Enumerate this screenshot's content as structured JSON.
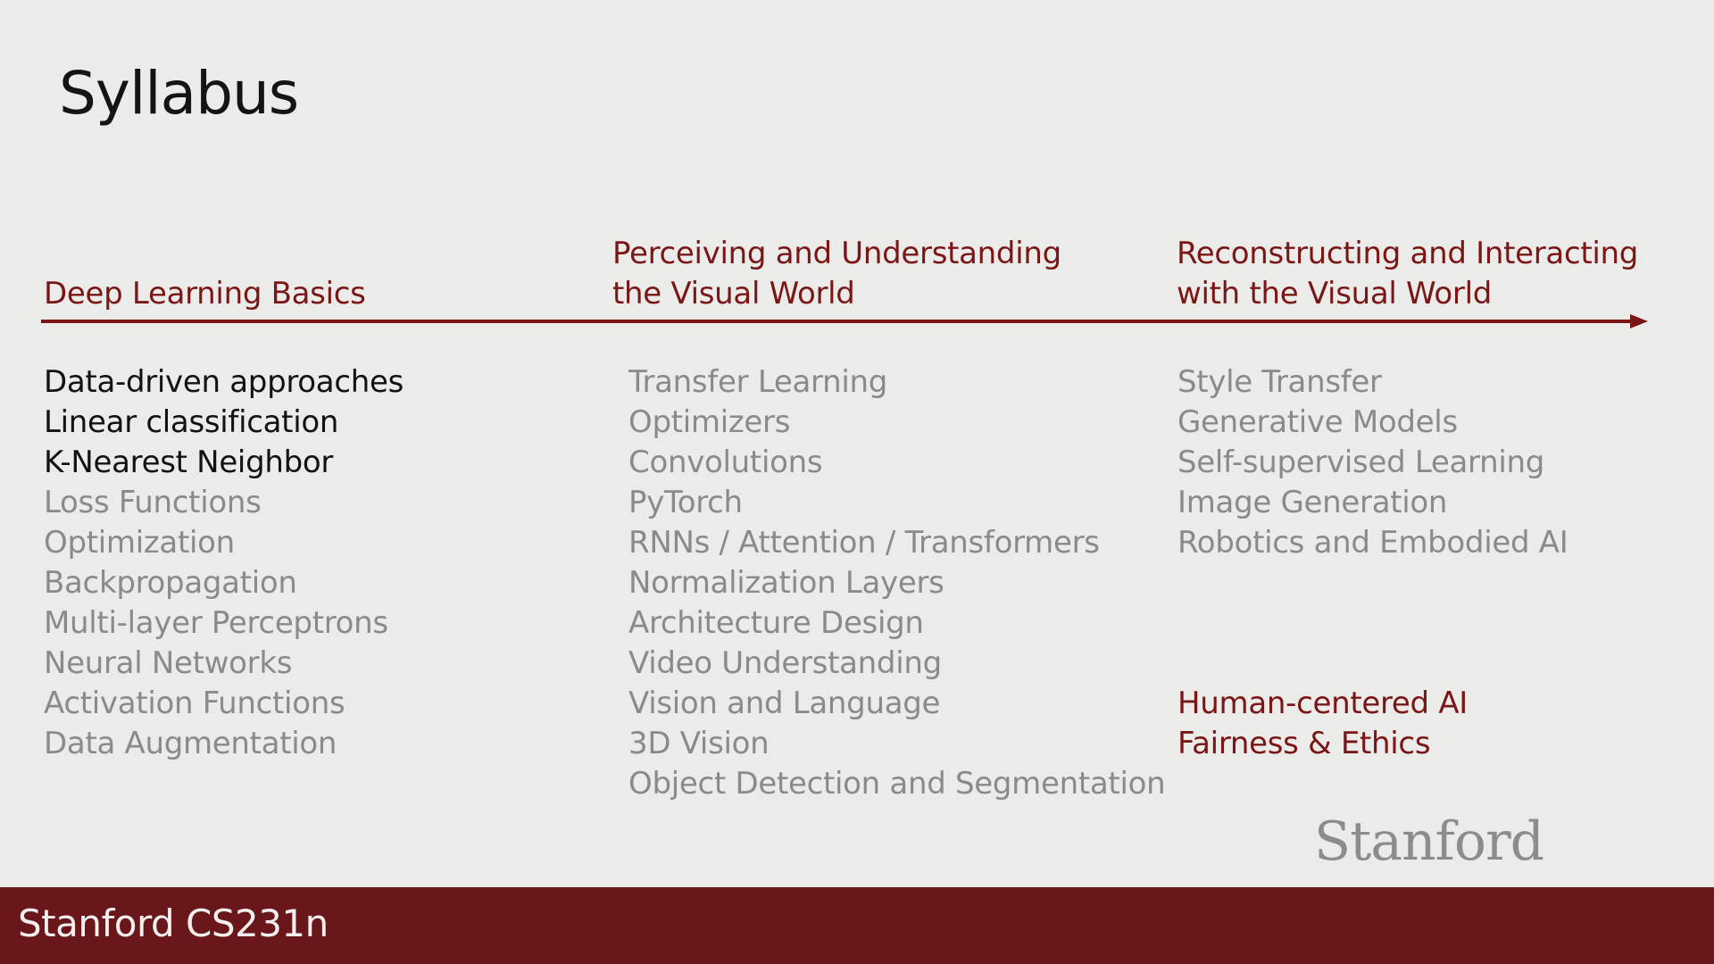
{
  "slide": {
    "title": "Syllabus",
    "footer": "Stanford CS231n",
    "logo_text": "Stanford"
  },
  "columns": [
    {
      "header_lines": [
        "Deep Learning Basics"
      ],
      "items": [
        {
          "text": "Data-driven approaches",
          "state": "active"
        },
        {
          "text": "Linear classification",
          "state": "active"
        },
        {
          "text": "K-Nearest Neighbor",
          "state": "active"
        },
        {
          "text": "Loss Functions",
          "state": "upcoming"
        },
        {
          "text": "Optimization",
          "state": "upcoming"
        },
        {
          "text": "Backpropagation",
          "state": "upcoming"
        },
        {
          "text": "Multi-layer Perceptrons",
          "state": "upcoming"
        },
        {
          "text": "Neural Networks",
          "state": "upcoming"
        },
        {
          "text": "Activation Functions",
          "state": "upcoming"
        },
        {
          "text": "Data Augmentation",
          "state": "upcoming"
        }
      ]
    },
    {
      "header_lines": [
        "Perceiving and Understanding",
        "the Visual World"
      ],
      "items": [
        {
          "text": "Transfer Learning",
          "state": "upcoming"
        },
        {
          "text": "Optimizers",
          "state": "upcoming"
        },
        {
          "text": "Convolutions",
          "state": "upcoming"
        },
        {
          "text": "PyTorch",
          "state": "upcoming"
        },
        {
          "text": "RNNs / Attention / Transformers",
          "state": "upcoming"
        },
        {
          "text": "Normalization Layers",
          "state": "upcoming"
        },
        {
          "text": "Architecture Design",
          "state": "upcoming"
        },
        {
          "text": "Video Understanding",
          "state": "upcoming"
        },
        {
          "text": "Vision and Language",
          "state": "upcoming"
        },
        {
          "text": "3D Vision",
          "state": "upcoming"
        },
        {
          "text": "Object Detection and Segmentation",
          "state": "upcoming"
        }
      ]
    },
    {
      "header_lines": [
        "Reconstructing and Interacting",
        "with the Visual World"
      ],
      "items": [
        {
          "text": "Style Transfer",
          "state": "upcoming"
        },
        {
          "text": "Generative Models",
          "state": "upcoming"
        },
        {
          "text": "Self-supervised Learning",
          "state": "upcoming"
        },
        {
          "text": "Image Generation",
          "state": "upcoming"
        },
        {
          "text": "Robotics and Embodied AI",
          "state": "upcoming"
        },
        {
          "text": "",
          "state": "gap"
        },
        {
          "text": "",
          "state": "gap"
        },
        {
          "text": "",
          "state": "gap"
        },
        {
          "text": "Human-centered AI",
          "state": "highlight"
        },
        {
          "text": "Fairness & Ethics",
          "state": "highlight"
        }
      ]
    }
  ],
  "colors": {
    "background": "#ebebea",
    "accent": "#7a1716",
    "footer_bar": "#69171a",
    "active_text": "#121212",
    "upcoming_text": "#8a8a8a"
  }
}
